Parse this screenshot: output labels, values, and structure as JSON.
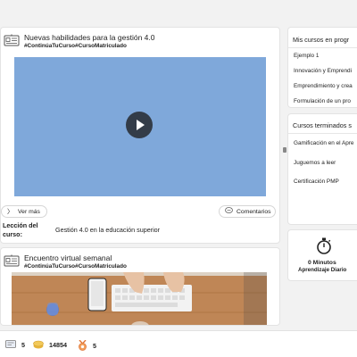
{
  "feed": {
    "post1": {
      "title": "Nuevas habilidades para la gestión 4.0",
      "tags": "#ContinúaTuCurso#CursoMatriculado",
      "ver_mas": "Ver más",
      "comentarios": "Comentarios",
      "lesson_label": "Lección del curso:",
      "lesson_value": "Gestión 4.0 en la educación superior"
    },
    "post2": {
      "title": "Encuentro virtual semanal",
      "tags": "#ContinúaTuCurso#CursoMatriculado"
    }
  },
  "sidebar": {
    "my_courses": {
      "title": "Mis cursos en progr",
      "items": [
        "Ejemplo 1",
        "Innovación y Emprendi",
        "Emprendimiento y crea",
        "Formulación de un pro"
      ]
    },
    "finished": {
      "title": "Cursos terminados s",
      "items": [
        "Gamificación en el Apre",
        "Juguemos a leer",
        "Certificación PMP"
      ]
    },
    "stats": {
      "value": "0 Minutos",
      "label": "Aprendizaje Diario"
    }
  },
  "bottom": {
    "certificates": "5",
    "coins": "14854",
    "medals": "5"
  },
  "colors": {
    "video": "#7fa8da",
    "coin": "#e7b53c",
    "medal": "#e0773a"
  }
}
